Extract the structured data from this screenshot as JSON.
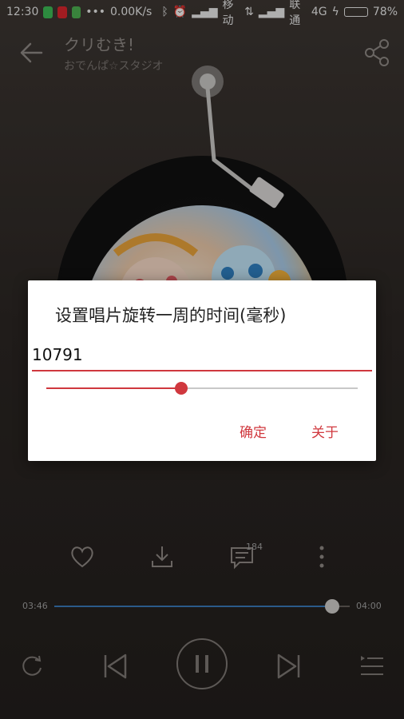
{
  "status_bar": {
    "time": "12:30",
    "network_speed": "0.00K/s",
    "carrier1": "移动",
    "carrier2": "联通",
    "network_type": "4G",
    "battery": "78%",
    "battery_level": 0.78,
    "colors": {
      "battery": "#6ad14a"
    }
  },
  "header": {
    "title": "クリむき!",
    "artist": "おでんぱ☆スタジオ",
    "icons": {
      "back": "arrow-left-icon",
      "share": "share-icon"
    }
  },
  "actions": {
    "comment_count": "184",
    "icons": [
      "heart-icon",
      "download-icon",
      "comment-icon",
      "more-vertical-icon"
    ]
  },
  "progress": {
    "current": "03:46",
    "total": "04:00",
    "fraction": 0.94
  },
  "controls": {
    "icons": [
      "repeat-icon",
      "previous-icon",
      "pause-icon",
      "next-icon",
      "playlist-icon"
    ]
  },
  "dialog": {
    "title": "设置唱片旋转一周的时间(毫秒)",
    "input_value": "10791",
    "slider_fraction": 0.434,
    "confirm_label": "确定",
    "about_label": "关于",
    "colors": {
      "accent": "#d0383e"
    }
  }
}
